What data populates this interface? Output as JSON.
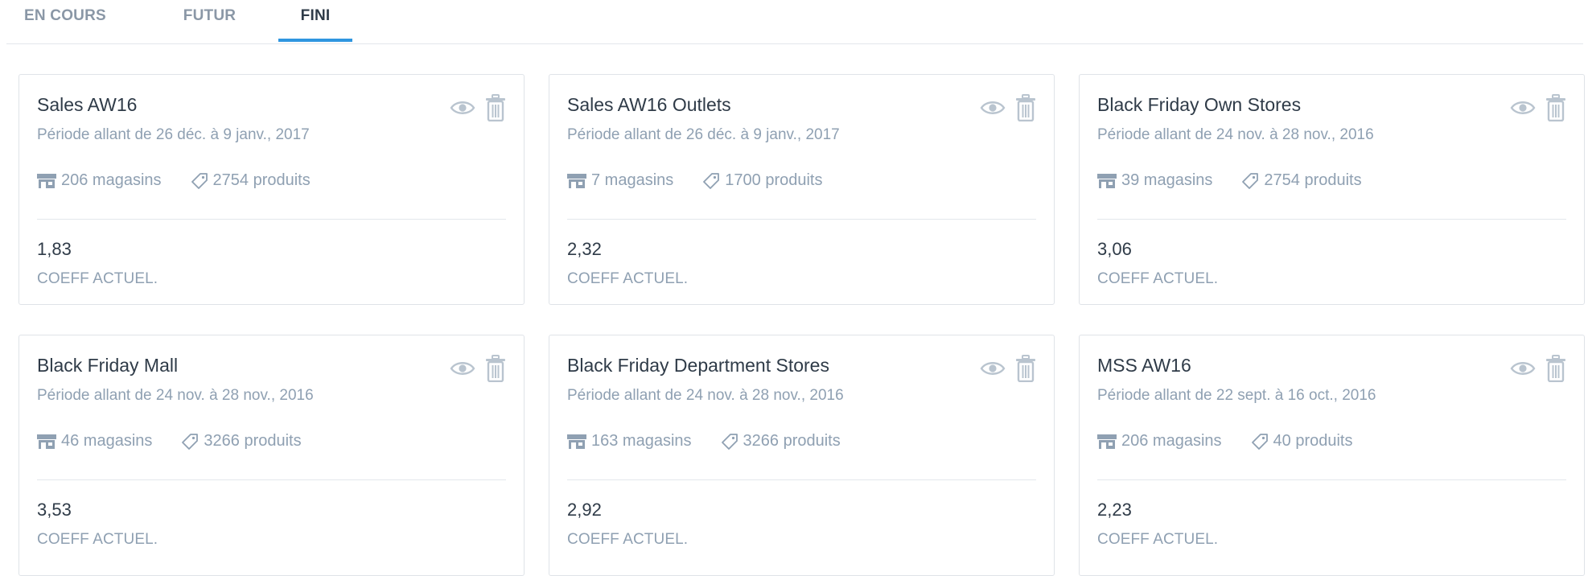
{
  "tabs": [
    {
      "label": "EN COURS",
      "active": false
    },
    {
      "label": "FUTUR",
      "active": false
    },
    {
      "label": "FINI",
      "active": true
    }
  ],
  "colors": {
    "accent": "#2f96e0",
    "text_primary": "#2f3b48",
    "text_muted": "#8fa0b2",
    "icon": "#b9c4cf"
  },
  "icons": {
    "view": "eye-icon",
    "delete": "trash-icon",
    "stores": "store-icon",
    "products": "tag-icon"
  },
  "cards": [
    {
      "title": "Sales AW16",
      "period": "Période allant de 26 déc. à 9 janv., 2017",
      "stores": "206 magasins",
      "products": "2754 produits",
      "coeff": "1,83",
      "coeff_label": "COEFF ACTUEL."
    },
    {
      "title": "Sales AW16 Outlets",
      "period": "Période allant de 26 déc. à 9 janv., 2017",
      "stores": "7 magasins",
      "products": "1700 produits",
      "coeff": "2,32",
      "coeff_label": "COEFF ACTUEL."
    },
    {
      "title": "Black Friday Own Stores",
      "period": "Période allant de 24 nov. à 28 nov., 2016",
      "stores": "39 magasins",
      "products": "2754 produits",
      "coeff": "3,06",
      "coeff_label": "COEFF ACTUEL."
    },
    {
      "title": "Black Friday Mall",
      "period": "Période allant de 24 nov. à 28 nov., 2016",
      "stores": "46 magasins",
      "products": "3266 produits",
      "coeff": "3,53",
      "coeff_label": "COEFF ACTUEL."
    },
    {
      "title": "Black Friday Department Stores",
      "period": "Période allant de 24 nov. à 28 nov., 2016",
      "stores": "163 magasins",
      "products": "3266 produits",
      "coeff": "2,92",
      "coeff_label": "COEFF ACTUEL."
    },
    {
      "title": "MSS AW16",
      "period": "Période allant de 22 sept. à 16 oct., 2016",
      "stores": "206 magasins",
      "products": "40 produits",
      "coeff": "2,23",
      "coeff_label": "COEFF ACTUEL."
    }
  ]
}
